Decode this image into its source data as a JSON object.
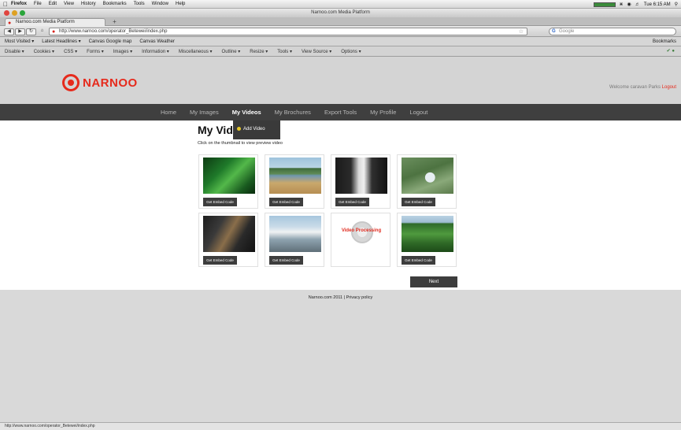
{
  "menubar": {
    "items": [
      "Firefox",
      "File",
      "Edit",
      "View",
      "History",
      "Bookmarks",
      "Tools",
      "Window",
      "Help"
    ],
    "clock": "Tue 6:15 AM"
  },
  "window": {
    "title": "Narnoo.com Media Platform"
  },
  "tab": {
    "label": "Narnoo.com Media Platform",
    "new_tab": "+"
  },
  "navigation": {
    "url": "http://www.narnoo.com/operator_Betewei/index.php",
    "search_engine": "G",
    "search_placeholder": "Google"
  },
  "bookmarks": {
    "items": [
      "Most Visited ▾",
      "Latest Headlines ▾",
      "Canvas Google map",
      "Canvas Weather"
    ],
    "right": "Bookmarks"
  },
  "addon_toolbar": {
    "items": [
      "Disable ▾",
      "Cookies ▾",
      "CSS ▾",
      "Forms ▾",
      "Images ▾",
      "Information ▾",
      "Miscellaneous ▾",
      "Outline ▾",
      "Resize ▾",
      "Tools ▾",
      "View Source ▾",
      "Options ▾"
    ]
  },
  "site": {
    "logo": "NARNOO",
    "welcome": "Welcome caravan Parks",
    "logout_link": "Logout",
    "nav": [
      "Home",
      "My Images",
      "My Videos",
      "My Brochures",
      "Export Tools",
      "My Profile",
      "Logout"
    ],
    "active_nav": "My Videos",
    "dropdown_item": "Add Video",
    "page_title": "My Videos",
    "subtitle": "Click on the thumbnail to view preview video",
    "embed_label": "Get Embed Code",
    "processing_label": "Video Processing",
    "next_label": "Next",
    "footer": "Narnoo.com 2011 | Privacy policy"
  },
  "videos": [
    {
      "kind": "leaf"
    },
    {
      "kind": "beach"
    },
    {
      "kind": "dark"
    },
    {
      "kind": "sign"
    },
    {
      "kind": "tent"
    },
    {
      "kind": "building"
    },
    {
      "kind": "processing"
    },
    {
      "kind": "forest"
    }
  ],
  "statusbar": {
    "text": "http://www.narnoo.com/operator_Betewei/index.php"
  }
}
